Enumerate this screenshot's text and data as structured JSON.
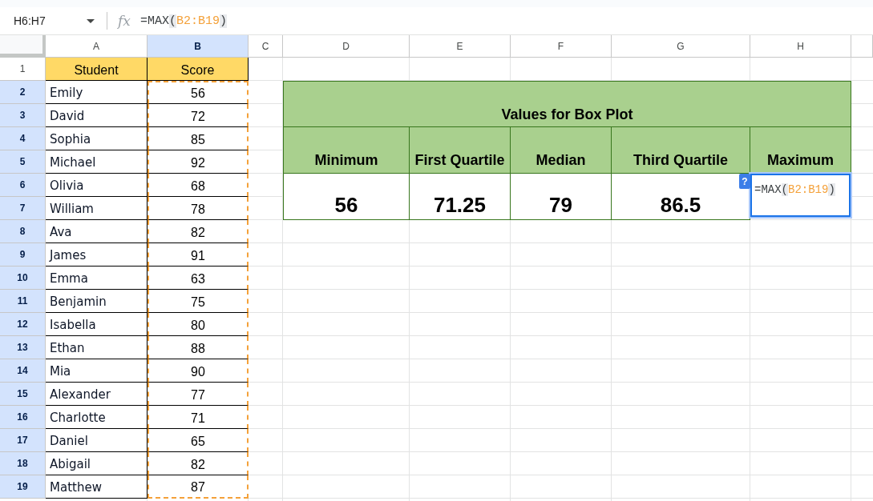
{
  "formula_bar": {
    "name_box": "H6:H7",
    "function_label": "fx",
    "formula": [
      {
        "kind": "function",
        "text": "=MAX"
      },
      {
        "kind": "paren",
        "text": "("
      },
      {
        "kind": "range",
        "text": "B2:B19"
      },
      {
        "kind": "paren",
        "text": ")"
      }
    ]
  },
  "sheet": {
    "columns": [
      {
        "label": "A",
        "highlighted": false
      },
      {
        "label": "B",
        "highlighted": true
      },
      {
        "label": "C",
        "highlighted": false
      },
      {
        "label": "D",
        "highlighted": false
      },
      {
        "label": "E",
        "highlighted": false
      },
      {
        "label": "F",
        "highlighted": false
      },
      {
        "label": "G",
        "highlighted": false
      },
      {
        "label": "H",
        "highlighted": false
      }
    ],
    "rows": [
      {
        "label": "1",
        "highlighted": false
      },
      {
        "label": "2",
        "highlighted": true
      },
      {
        "label": "3",
        "highlighted": true
      },
      {
        "label": "4",
        "highlighted": true
      },
      {
        "label": "5",
        "highlighted": true
      },
      {
        "label": "6",
        "highlighted": true
      },
      {
        "label": "7",
        "highlighted": true
      },
      {
        "label": "8",
        "highlighted": true
      },
      {
        "label": "9",
        "highlighted": true
      },
      {
        "label": "10",
        "highlighted": true
      },
      {
        "label": "11",
        "highlighted": true
      },
      {
        "label": "12",
        "highlighted": true
      },
      {
        "label": "13",
        "highlighted": true
      },
      {
        "label": "14",
        "highlighted": true
      },
      {
        "label": "15",
        "highlighted": true
      },
      {
        "label": "16",
        "highlighted": true
      },
      {
        "label": "17",
        "highlighted": true
      },
      {
        "label": "18",
        "highlighted": true
      },
      {
        "label": "19",
        "highlighted": true
      }
    ]
  },
  "student_table": {
    "columns": [
      {
        "label": "Student",
        "referenced": false
      },
      {
        "label": "Score",
        "referenced": true
      }
    ],
    "rows": [
      {
        "student": "Emily",
        "score": "56"
      },
      {
        "student": "David",
        "score": "72"
      },
      {
        "student": "Sophia",
        "score": "85"
      },
      {
        "student": "Michael",
        "score": "92"
      },
      {
        "student": "Olivia",
        "score": "68"
      },
      {
        "student": "William",
        "score": "78"
      },
      {
        "student": "Ava",
        "score": "82"
      },
      {
        "student": "James",
        "score": "91"
      },
      {
        "student": "Emma",
        "score": "63"
      },
      {
        "student": "Benjamin",
        "score": "75"
      },
      {
        "student": "Isabella",
        "score": "80"
      },
      {
        "student": "Ethan",
        "score": "88"
      },
      {
        "student": "Mia",
        "score": "90"
      },
      {
        "student": "Alexander",
        "score": "77"
      },
      {
        "student": "Charlotte",
        "score": "71"
      },
      {
        "student": "Daniel",
        "score": "65"
      },
      {
        "student": "Abigail",
        "score": "82"
      },
      {
        "student": "Matthew",
        "score": "87"
      }
    ]
  },
  "box_plot_table": {
    "title": "Values for Box Plot",
    "stats": [
      {
        "label": "Minimum",
        "value": "56",
        "editing": false
      },
      {
        "label": "First Quartile",
        "value": "71.25",
        "editing": false
      },
      {
        "label": "Median",
        "value": "79",
        "editing": false
      },
      {
        "label": "Third Quartile",
        "value": "86.5",
        "editing": false
      },
      {
        "label": "Maximum",
        "editing": true,
        "help_badge": "?",
        "formula": [
          {
            "kind": "function",
            "text": "=MAX"
          },
          {
            "kind": "paren",
            "text": "("
          },
          {
            "kind": "range",
            "text": "B2:B19"
          },
          {
            "kind": "paren",
            "text": ")"
          }
        ]
      }
    ]
  }
}
